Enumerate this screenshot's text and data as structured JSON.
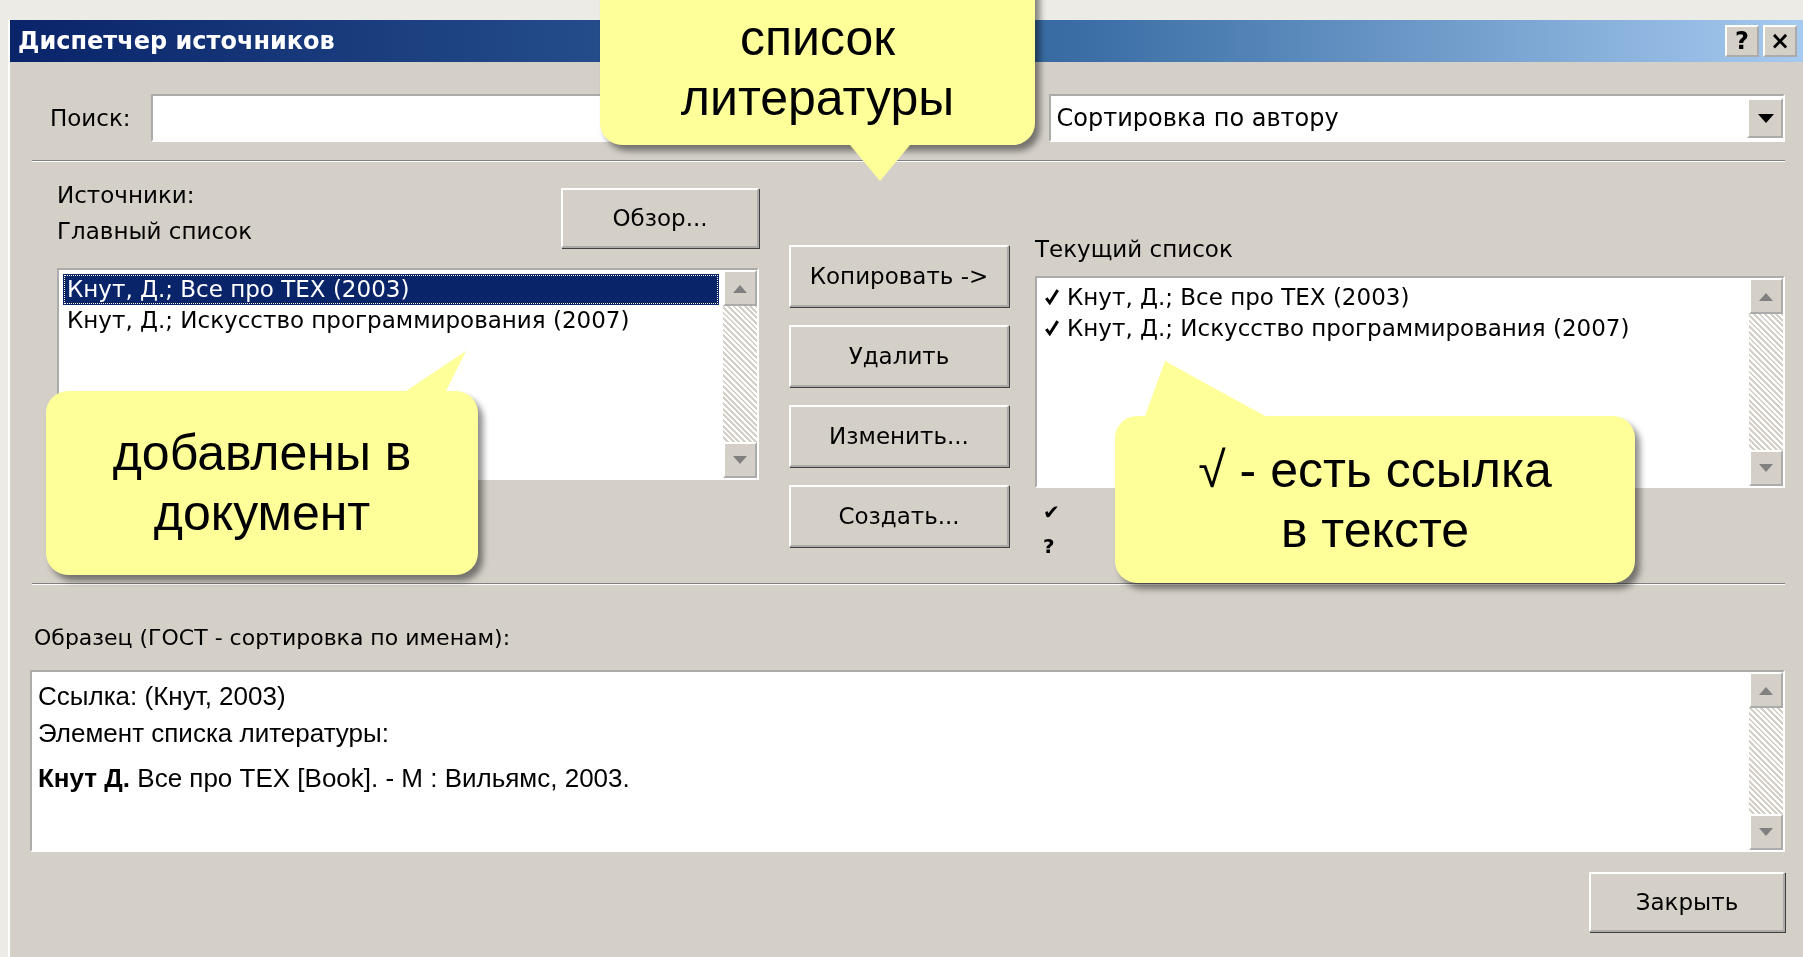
{
  "window": {
    "title": "Диспетчер источников",
    "buttons": [
      "?",
      "×"
    ]
  },
  "search": {
    "label": "Поиск:"
  },
  "sort": {
    "value": "Сортировка по автору"
  },
  "sources": {
    "label": "Источники:",
    "browse_button": "Обзор..."
  },
  "master_list": {
    "label": "Главный список",
    "items": [
      {
        "text": "Кнут, Д.; Все про TEX (2003)",
        "selected": true
      },
      {
        "text": "Кнут, Д.; Искусство программирования (2007)",
        "selected": false
      }
    ]
  },
  "actions": [
    "Копировать ->",
    "Удалить",
    "Изменить...",
    "Создать..."
  ],
  "current_list": {
    "label": "Текущий список",
    "items": [
      {
        "text": "Кнут, Д.; Все про TEX (2003)",
        "checked": true
      },
      {
        "text": "Кнут, Д.; Искусство программирования (2007)",
        "checked": true
      }
    ]
  },
  "legend": [
    "✔",
    "?"
  ],
  "preview": {
    "label": "Образец (ГОСТ - сортировка по именам):",
    "lines": [
      "Ссылка: (Кнут, 2003)",
      "Элемент списка литературы:",
      "**Кнут Д.** Все про TEX [Book]. - М : Вильямс, 2003."
    ]
  },
  "close_button": "Закрыть",
  "callouts": [
    {
      "kind": "top",
      "lines": [
        "список",
        "литературы"
      ]
    },
    {
      "kind": "left",
      "lines": [
        "добавлены в",
        "документ"
      ]
    },
    {
      "kind": "right",
      "lines": [
        "√ - есть  ссылка",
        "в тексте"
      ]
    }
  ]
}
